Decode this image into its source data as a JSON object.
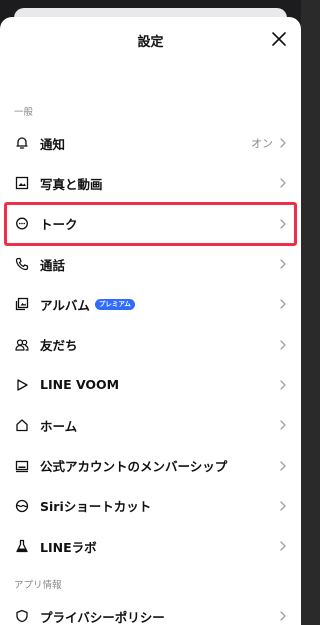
{
  "title": "設定",
  "sections": {
    "general": "一般",
    "app_info": "アプリ情報"
  },
  "rows": [
    {
      "label": "通知",
      "value": "オン",
      "icon": "bell-icon"
    },
    {
      "label": "写真と動画",
      "icon": "photo-icon"
    },
    {
      "label": "トーク",
      "icon": "chat-bubble-icon",
      "highlighted": true
    },
    {
      "label": "通話",
      "icon": "phone-icon"
    },
    {
      "label": "アルバム",
      "badge": "プレミアム",
      "icon": "album-icon"
    },
    {
      "label": "友だち",
      "icon": "friends-icon"
    },
    {
      "label": "LINE VOOM",
      "icon": "play-icon"
    },
    {
      "label": "ホーム",
      "icon": "home-icon"
    },
    {
      "label": "公式アカウントのメンバーシップ",
      "icon": "membership-icon"
    },
    {
      "label": "Siriショートカット",
      "icon": "siri-icon"
    },
    {
      "label": "LINEラボ",
      "icon": "flask-icon"
    }
  ],
  "app_info_rows": [
    {
      "label": "プライバシーポリシー"
    }
  ],
  "colors": {
    "highlight": "#ee2f4a",
    "badge": "#2f6bff"
  }
}
